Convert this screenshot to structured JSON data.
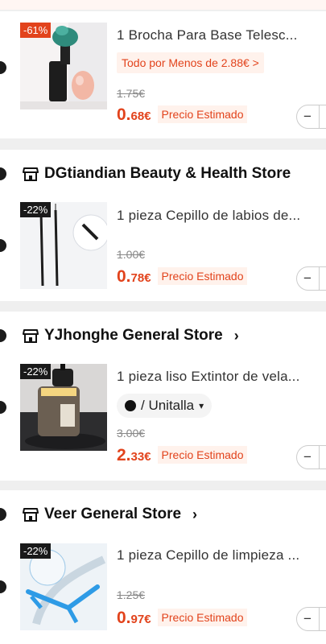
{
  "colors": {
    "accent": "#e2431c",
    "badge_bg": "#e2431c",
    "page_bg": "#efefef"
  },
  "items": [
    {
      "discount": "-61%",
      "title": "1 Brocha Para Base Telesc...",
      "promo": "Todo por Menos de 2.88€ >",
      "old_price": "1.75€",
      "price_int": "0.",
      "price_dec": "68€",
      "estimate_label": "Precio Estimado"
    },
    {
      "store_name": "DGtiandian Beauty & Health Store",
      "discount": "-22%",
      "title": "1 pieza Cepillo de labios de...",
      "old_price": "1.00€",
      "price_int": "0.",
      "price_dec": "78€",
      "estimate_label": "Precio Estimado"
    },
    {
      "store_name": "YJhonghe General Store",
      "store_chevron": "›",
      "discount": "-22%",
      "title": "1 pieza liso Extintor de vela...",
      "variant": "/ Unitalla",
      "old_price": "3.00€",
      "price_int": "2.",
      "price_dec": "33€",
      "estimate_label": "Precio Estimado"
    },
    {
      "store_name": "Veer General Store",
      "store_chevron": "›",
      "discount": "-22%",
      "title": "1 pieza Cepillo de limpieza ...",
      "old_price": "1.25€",
      "price_int": "0.",
      "price_dec": "97€",
      "estimate_label": "Precio Estimado"
    }
  ],
  "icons": {
    "store": "store-icon",
    "radio": "radio-selected-icon",
    "minus": "minus-icon",
    "chevron": "chevron-right-icon"
  }
}
